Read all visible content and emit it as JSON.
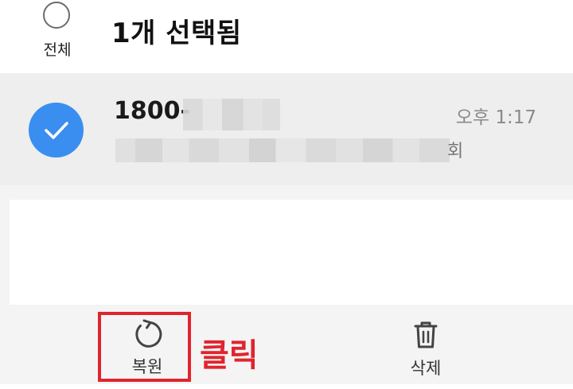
{
  "header": {
    "select_all_label": "전체",
    "title": "1개 선택됨"
  },
  "message": {
    "sender": "1800-",
    "time": "오후 1:17",
    "preview_tail": "회",
    "selected": true
  },
  "actions": {
    "restore_label": "복원",
    "delete_label": "삭제"
  },
  "annotation": {
    "text": "클릭",
    "color": "#e0242e"
  },
  "colors": {
    "accent": "#3a8ef0",
    "row_selected_bg": "#eeeeee"
  }
}
